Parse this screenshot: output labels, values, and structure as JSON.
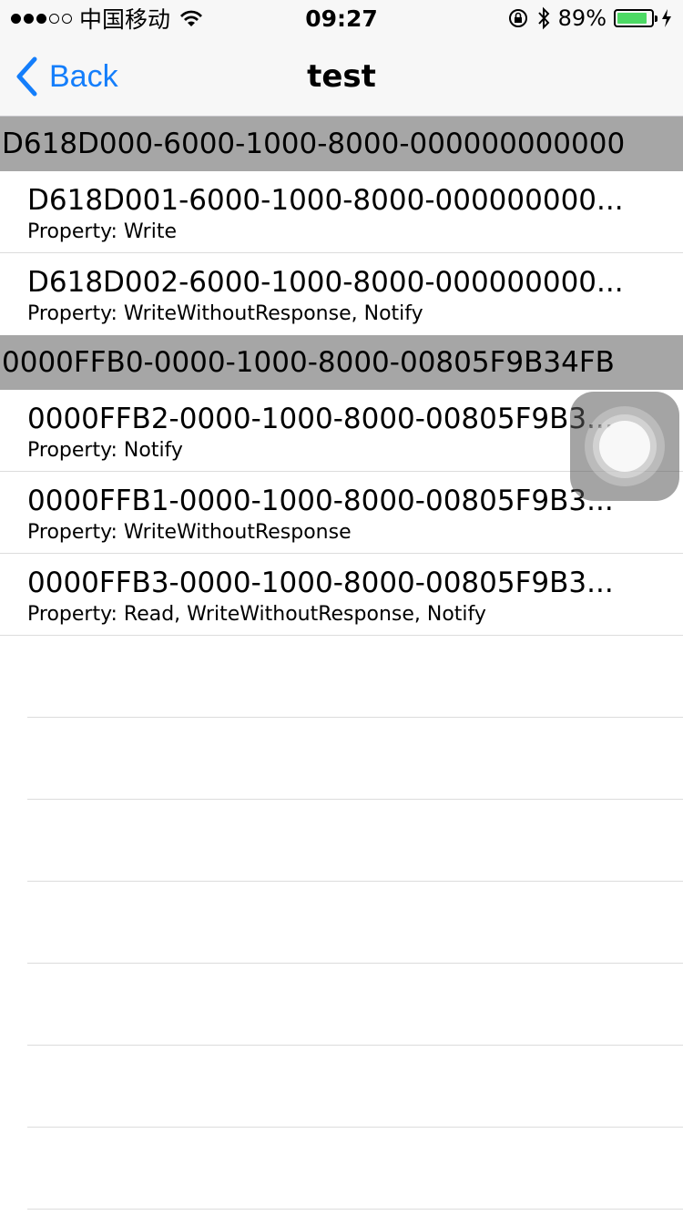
{
  "status_bar": {
    "signal_dots_filled": 3,
    "signal_dots_total": 5,
    "carrier": "中国移动",
    "time": "09:27",
    "battery_percent": "89%",
    "battery_level": 0.89,
    "icons": [
      "wifi-icon",
      "rotation-lock-icon",
      "bluetooth-icon",
      "battery-icon",
      "charging-bolt-icon"
    ]
  },
  "nav": {
    "back_label": "Back",
    "title": "test"
  },
  "sections": [
    {
      "header": "D618D000-6000-1000-8000-000000000000",
      "rows": [
        {
          "title": "D618D001-6000-1000-8000-000000000...",
          "subtitle": "Property: Write"
        },
        {
          "title": "D618D002-6000-1000-8000-000000000...",
          "subtitle": "Property: WriteWithoutResponse, Notify"
        }
      ]
    },
    {
      "header": "0000FFB0-0000-1000-8000-00805F9B34FB",
      "rows": [
        {
          "title": "0000FFB2-0000-1000-8000-00805F9B3...",
          "subtitle": "Property: Notify"
        },
        {
          "title": "0000FFB1-0000-1000-8000-00805F9B3...",
          "subtitle": "Property: WriteWithoutResponse"
        },
        {
          "title": "0000FFB3-0000-1000-8000-00805F9B3...",
          "subtitle": "Property: Read, WriteWithoutResponse, Notify"
        }
      ]
    }
  ],
  "colors": {
    "accent": "#147efb",
    "section_header_bg": "#a6a6a6",
    "battery_fill": "#4cd964"
  }
}
